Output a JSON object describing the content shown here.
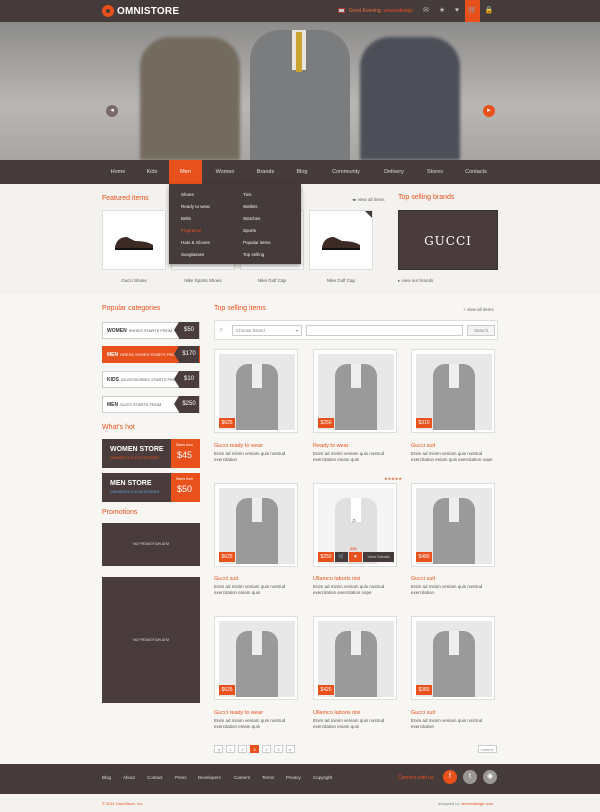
{
  "brand": {
    "name_a": "OMNI",
    "name_b": "STORE",
    "accent": "#e8501c",
    "dark": "#463b3b"
  },
  "topbar": {
    "greeting": "Good Evening,",
    "user": "vervesdesign",
    "icons": [
      "user-icon",
      "chat-icon",
      "star-icon",
      "heart-icon",
      "cart-icon",
      "lock-icon"
    ]
  },
  "nav": {
    "items": [
      "Home",
      "Kids",
      "Men",
      "Women",
      "Brands",
      "Blog",
      "Community",
      "Delivery",
      "Stores",
      "Contacts"
    ],
    "active": "Men"
  },
  "dropdown": {
    "col1": [
      "Shoes",
      "Ready to wear",
      "Belts",
      "Fragrance",
      "Hats & Gloves",
      "Sunglasses"
    ],
    "col2": [
      "Ties",
      "Wallets",
      "Watches",
      "Sports",
      "Popular items",
      "Top selling"
    ],
    "highlight": "Fragrance"
  },
  "featured": {
    "title": "Featured items",
    "view_all": "view all items",
    "items": [
      "Gucci Shoes",
      "Nike Sports Shoes",
      "Nike Golf Cap",
      "Nike Golf Cap"
    ]
  },
  "brands": {
    "title": "Top selling brands",
    "logo": "GUCCI",
    "link": "view our brands"
  },
  "categories": {
    "title": "Popular categories",
    "items": [
      {
        "name": "WOMEN",
        "sub": "SHOES STARTS FROM",
        "price": "$50"
      },
      {
        "name": "MEN",
        "sub": "DRESS SHOES STARTS FROM",
        "price": "$170"
      },
      {
        "name": "KIDS",
        "sub": "ACCESSORIES STARTS FROM",
        "price": "$10"
      },
      {
        "name": "MEN",
        "sub": "SUITS STARTS FROM",
        "price": "$250"
      }
    ]
  },
  "hot": {
    "title": "What's hot",
    "stores": [
      {
        "name": "WOMEN STORE",
        "sub": "GARMENTS & ACCESSORIES",
        "starts": "Starts from",
        "price": "45"
      },
      {
        "name": "MEN STORE",
        "sub": "GARMENTS & ACCESSORIES",
        "starts": "Starts from",
        "price": "50"
      }
    ]
  },
  "promotions": {
    "title": "Promotions",
    "empty": "NO PROMOTION ATM"
  },
  "top_selling": {
    "title": "Top selling items",
    "view_all": "view all items",
    "select_placeholder": "Choose Brand",
    "search_button": "Search",
    "products": [
      {
        "price": "$625",
        "title": "Gucci ready to wear",
        "desc": "Enim ad minim veniam quis nostrud exercitation"
      },
      {
        "price": "$250",
        "title": "Ready to wear",
        "desc": "Enim ad minim veniam quis nostrud exercitation eniam quis"
      },
      {
        "price": "$310",
        "title": "Gucci suit",
        "desc": "Enim ad minim veniam quis nostrud exercitation eniam quis exercitation nope"
      },
      {
        "price": "$625",
        "title": "Gucci suit",
        "desc": "Enim ad minim veniam quis nostrud exercitation eniam quis"
      },
      {
        "price": "$250",
        "title": "Ullamco laboris nisi",
        "desc": "Enim ad minim veniam quis nostrud exercitation exercitation nope"
      },
      {
        "price": "$480",
        "title": "Gucci suit",
        "desc": "Enim ad minim veniam quis nostrud exercitation"
      },
      {
        "price": "$625",
        "title": "Gucci ready to wear",
        "desc": "Enim ad minim veniam quis nostrud exercitation eniam quis"
      },
      {
        "price": "$420",
        "title": "Ullamco laboris nisi",
        "desc": "Enim ad minim veniam quis nostrud exercitation eniam quis"
      },
      {
        "price": "$380",
        "title": "Gucci suit",
        "desc": "Enim ad minim veniam quis nostrud exercitation"
      }
    ],
    "hover": {
      "badge": "$$$",
      "details": "View Details"
    }
  },
  "pager": {
    "prev": "◂",
    "pages": [
      "1",
      "2",
      "3",
      "4",
      "5"
    ],
    "next": "▸",
    "current": "3",
    "more": "more ▸"
  },
  "footer": {
    "links": [
      "Blog",
      "About",
      "Contact",
      "Press",
      "Developers",
      "Careers",
      "Terms",
      "Privacy",
      "Copyright"
    ],
    "connect": "Connect with us",
    "copyright": "© 2011 OmniStore, Inc.",
    "designed_by": "designed by",
    "designer": "vervesdesign.com"
  }
}
